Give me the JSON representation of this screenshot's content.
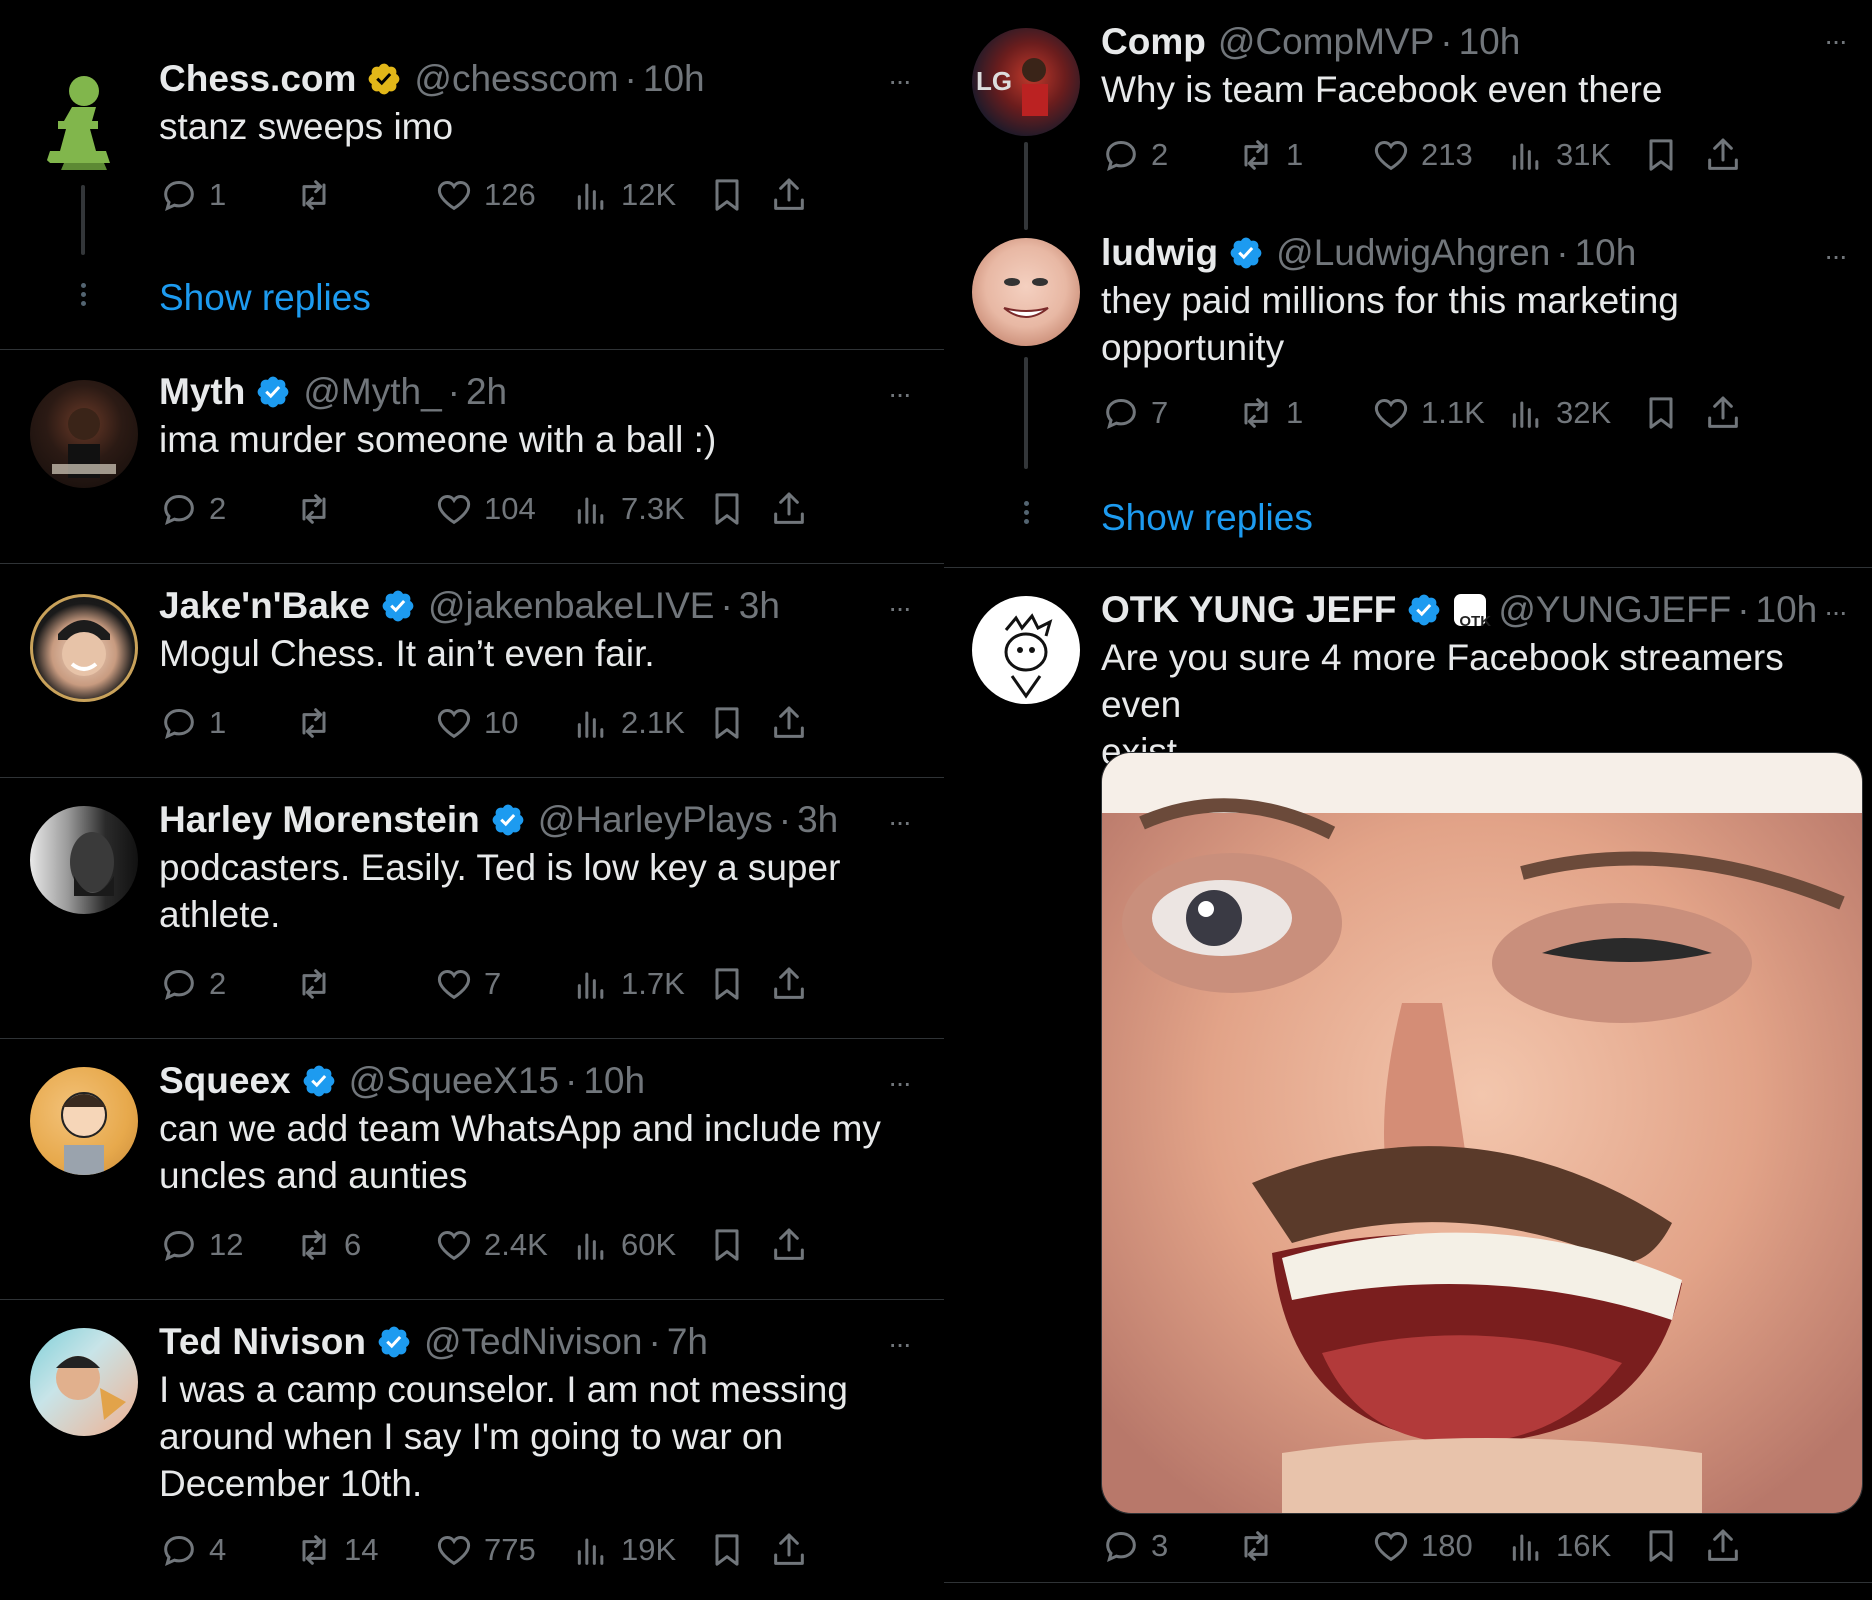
{
  "left_tweets": [
    {
      "name": "Chess.com",
      "badge": "gold",
      "handle": "@chesscom",
      "time": "10h",
      "text": "stanz sweeps imo",
      "stats": {
        "reply": "1",
        "retweet": "",
        "like": "126",
        "views": "12K"
      },
      "show_replies": "Show replies"
    },
    {
      "name": "Myth",
      "badge": "blue",
      "handle": "@Myth_",
      "time": "2h",
      "text": "ima murder someone with a ball :)",
      "stats": {
        "reply": "2",
        "retweet": "",
        "like": "104",
        "views": "7.3K"
      }
    },
    {
      "name": "Jake'n'Bake",
      "badge": "blue",
      "handle": "@jakenbakeLIVE",
      "time": "3h",
      "text": "Mogul Chess. It ain’t even fair.",
      "stats": {
        "reply": "1",
        "retweet": "",
        "like": "10",
        "views": "2.1K"
      }
    },
    {
      "name": "Harley Morenstein",
      "badge": "blue",
      "handle": "@HarleyPlays",
      "time": "3h",
      "text_lines": [
        "podcasters. Easily. Ted is low key a super",
        "athlete."
      ],
      "stats": {
        "reply": "2",
        "retweet": "",
        "like": "7",
        "views": "1.7K"
      }
    },
    {
      "name": "Squeex",
      "badge": "blue",
      "handle": "@SqueeX15",
      "time": "10h",
      "text_lines": [
        "can we add team WhatsApp and include my",
        "uncles and aunties"
      ],
      "stats": {
        "reply": "12",
        "retweet": "6",
        "like": "2.4K",
        "views": "60K"
      }
    },
    {
      "name": "Ted Nivison",
      "badge": "blue",
      "handle": "@TedNivison",
      "time": "7h",
      "text_lines": [
        "I was a camp counselor. I am not messing",
        "around when I say I'm going to war on",
        "December 10th."
      ],
      "stats": {
        "reply": "4",
        "retweet": "14",
        "like": "775",
        "views": "19K"
      }
    }
  ],
  "right_tweets": [
    {
      "name": "Comp",
      "handle": "@CompMVP",
      "time": "10h",
      "text": "Why is team Facebook even there",
      "stats": {
        "reply": "2",
        "retweet": "1",
        "like": "213",
        "views": "31K"
      }
    },
    {
      "name": "ludwig",
      "badge": "blue",
      "handle": "@LudwigAhgren",
      "time": "10h",
      "text_lines": [
        "they paid millions for this marketing",
        "opportunity"
      ],
      "stats": {
        "reply": "7",
        "retweet": "1",
        "like": "1.1K",
        "views": "32K"
      },
      "show_replies": "Show replies"
    },
    {
      "name": "OTK YUNG JEFF",
      "badge": "blue",
      "affiliate_badge": "OTK",
      "handle": "@YUNGJEFF",
      "time": "10h",
      "text_lines": [
        "Are you sure 4 more Facebook streamers even",
        "exist"
      ],
      "stats": {
        "reply": "3",
        "retweet": "",
        "like": "180",
        "views": "16K"
      }
    }
  ],
  "icons": {
    "reply": "reply-icon",
    "retweet": "retweet-icon",
    "like": "like-icon",
    "views": "views-icon",
    "bookmark": "bookmark-icon",
    "share": "share-icon",
    "more": "more-icon",
    "verified": "verified-badge-icon"
  },
  "colors": {
    "background": "#000000",
    "text": "#e7e9ea",
    "muted": "#71767b",
    "link": "#1d9bf0",
    "verified_blue": "#1d9bf0",
    "verified_gold": "#e2b719",
    "divider": "#2f3336"
  },
  "more_glyph": "···"
}
